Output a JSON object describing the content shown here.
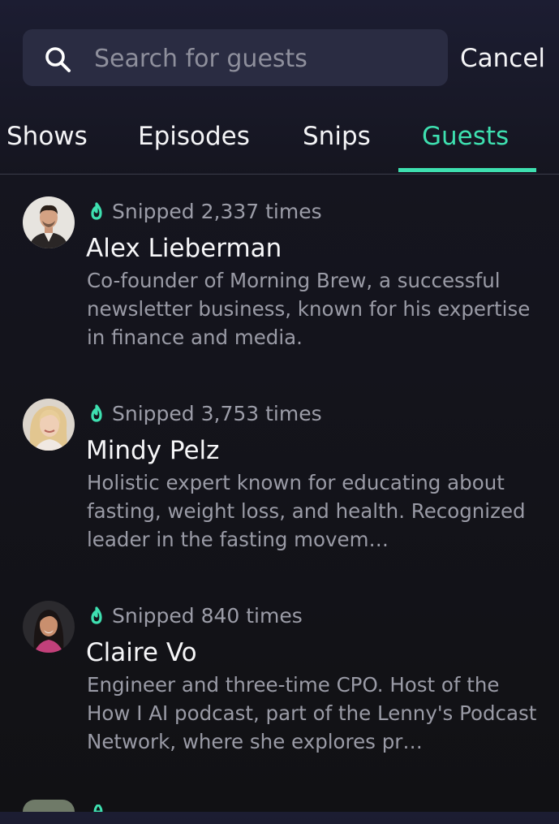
{
  "search": {
    "placeholder": "Search for guests",
    "value": "",
    "cancel_label": "Cancel"
  },
  "tabs": [
    {
      "label": "Shows",
      "active": false
    },
    {
      "label": "Episodes",
      "active": false
    },
    {
      "label": "Snips",
      "active": false
    },
    {
      "label": "Guests",
      "active": true
    }
  ],
  "colors": {
    "accent": "#3ee0b0",
    "search_bg": "#2a2c42",
    "muted_text": "#9a9ba6"
  },
  "guests": [
    {
      "snips": "Snipped 2,337 times",
      "name": "Alex Lieberman",
      "description": "Co-founder of Morning Brew, a successful newsletter business, known for his expertise in finance and media."
    },
    {
      "snips": "Snipped 3,753 times",
      "name": "Mindy Pelz",
      "description": "Holistic expert known for educating about fasting, weight loss, and health. Recognized leader in the fasting movem…"
    },
    {
      "snips": "Snipped 840 times",
      "name": "Claire Vo",
      "description": "Engineer and three-time CPO. Host of the How I AI podcast, part of the Lenny's Podcast Network, where she explores pr…"
    }
  ]
}
